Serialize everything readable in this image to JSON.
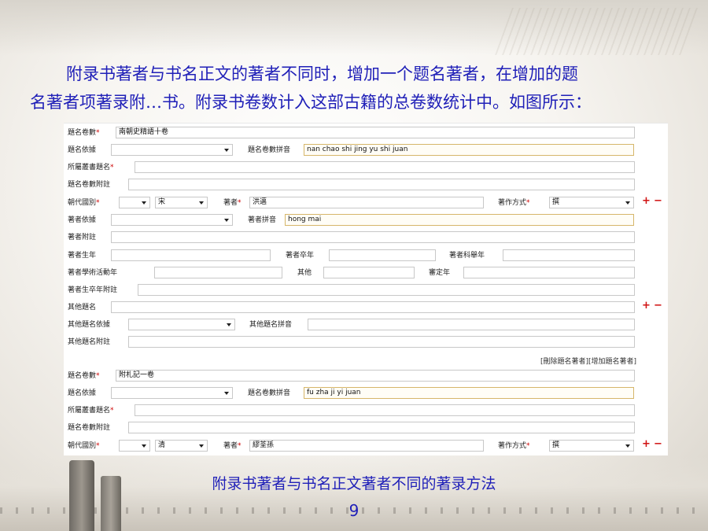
{
  "paragraph": {
    "line1": "附录书著者与书名正文的著者不同时，增加一个题名著者，在增加的题",
    "line2": "名著者项著录附…书。附录书卷数计入这部古籍的总卷数统计中。如图所示："
  },
  "caption": "附录书著者与书名正文著者不同的著录方法",
  "page_number": "9",
  "required_mark": "*",
  "plus": "+",
  "minus": "−",
  "labels": {
    "title_volumes": "題名卷數",
    "title_basis": "題名依據",
    "title_volumes_pinyin": "題名卷數拼音",
    "series_title": "所屬叢書題名",
    "title_volumes_note": "題名卷數附註",
    "dynasty": "朝代國別",
    "author": "著者",
    "work_mode": "著作方式",
    "author_basis": "著者依據",
    "author_pinyin": "著者拼音",
    "author_note": "著者附註",
    "birth_year": "著者生年",
    "death_year": "著者卒年",
    "exam_year": "著者科舉年",
    "activity_year": "著者學術活動年",
    "other": "其他",
    "revise_year": "審定年",
    "birth_death_note": "著者生卒年附註",
    "other_title": "其他題名",
    "other_title_basis": "其他題名依據",
    "other_title_pinyin": "其他題名拼音",
    "other_title_note": "其他題名附註"
  },
  "links": {
    "delete_author": "[刪除題名著者]",
    "add_author": "[增加題名著者]"
  },
  "form1": {
    "title_volumes": "南朝史精語十卷",
    "title_volumes_pinyin": "nan chao shi jing yu shi juan",
    "dynasty_country": "",
    "dynasty": "宋",
    "author": "洪邁",
    "work_mode": "撰",
    "author_pinyin": "hong mai"
  },
  "form2": {
    "title_volumes": "附札記一卷",
    "title_volumes_pinyin": "fu zha ji yi juan",
    "dynasty_country": "",
    "dynasty": "清",
    "author": "繆荃孫",
    "work_mode": "撰"
  }
}
